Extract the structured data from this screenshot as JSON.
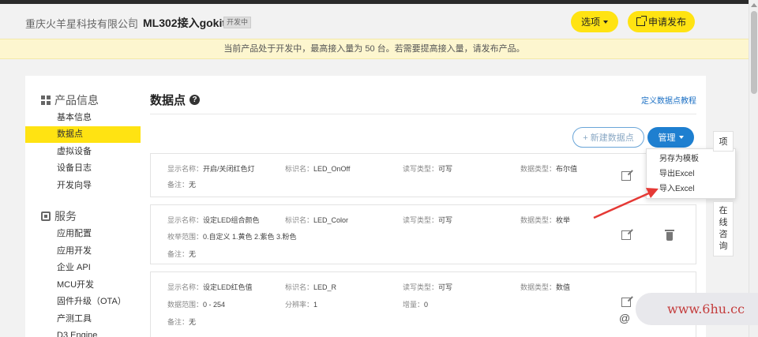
{
  "header": {
    "company": "重庆火羊星科技有限公司",
    "separator": "/",
    "product": "ML302接入gokit3",
    "badge": "开发中",
    "options_label": "选项",
    "publish_label": "申请发布"
  },
  "notice": "当前产品处于开发中，最高接入量为 50 台。若需要提高接入量，请发布产品。",
  "sidebar": {
    "sections": [
      {
        "title": "产品信息",
        "icon": "grid-icon",
        "items": [
          "基本信息",
          "数据点",
          "虚拟设备",
          "设备日志",
          "开发向导"
        ]
      },
      {
        "title": "服务",
        "icon": "service-icon",
        "items": [
          "应用配置",
          "应用开发",
          "企业 API",
          "MCU开发",
          "固件升级（OTA）",
          "产测工具",
          "D3 Engine"
        ]
      }
    ],
    "active_item": "数据点"
  },
  "main": {
    "title": "数据点",
    "tutorial_link": "定义数据点教程",
    "new_button": "+ 新建数据点",
    "manage_button": "管理",
    "dropdown": [
      "另存为模板",
      "导出Excel",
      "导入Excel"
    ]
  },
  "datapoints": [
    {
      "display_label": "显示名称：",
      "display_name": "开启/关闭红色灯",
      "id_label": "标识名：",
      "id_name": "LED_OnOff",
      "rw_label": "读写类型：",
      "rw_type": "可写",
      "dtype_label": "数据类型：",
      "dtype": "布尔值",
      "note_label": "备注：",
      "note": "无"
    },
    {
      "display_label": "显示名称：",
      "display_name": "设定LED组合颜色",
      "id_label": "标识名：",
      "id_name": "LED_Color",
      "rw_label": "读写类型：",
      "rw_type": "可写",
      "dtype_label": "数据类型：",
      "dtype": "枚举",
      "enum_label": "枚举范围：",
      "enum_range": "0.自定义 1.黄色 2.紫色 3.粉色",
      "note_label": "备注：",
      "note": "无"
    },
    {
      "display_label": "显示名称：",
      "display_name": "设定LED红色值",
      "id_label": "标识名：",
      "id_name": "LED_R",
      "rw_label": "读写类型：",
      "rw_type": "可写",
      "dtype_label": "数据类型：",
      "dtype": "数值",
      "range_label": "数据范围：",
      "range": "0 - 254",
      "resolution_label": "分辨率：",
      "resolution": "1",
      "increment_label": "增量：",
      "increment": "0",
      "note_label": "备注：",
      "note": "无"
    }
  ],
  "float_tabs": {
    "item": "项",
    "consult": [
      "在",
      "线",
      "咨",
      "询"
    ]
  },
  "watermark": "www.6hu.cc",
  "watermark_glyph": "@",
  "colors": {
    "accent_yellow": "#ffe312",
    "primary_blue": "#1e7fd0",
    "arrow_red": "#e53935",
    "notice_bg": "#fdf6cf"
  }
}
